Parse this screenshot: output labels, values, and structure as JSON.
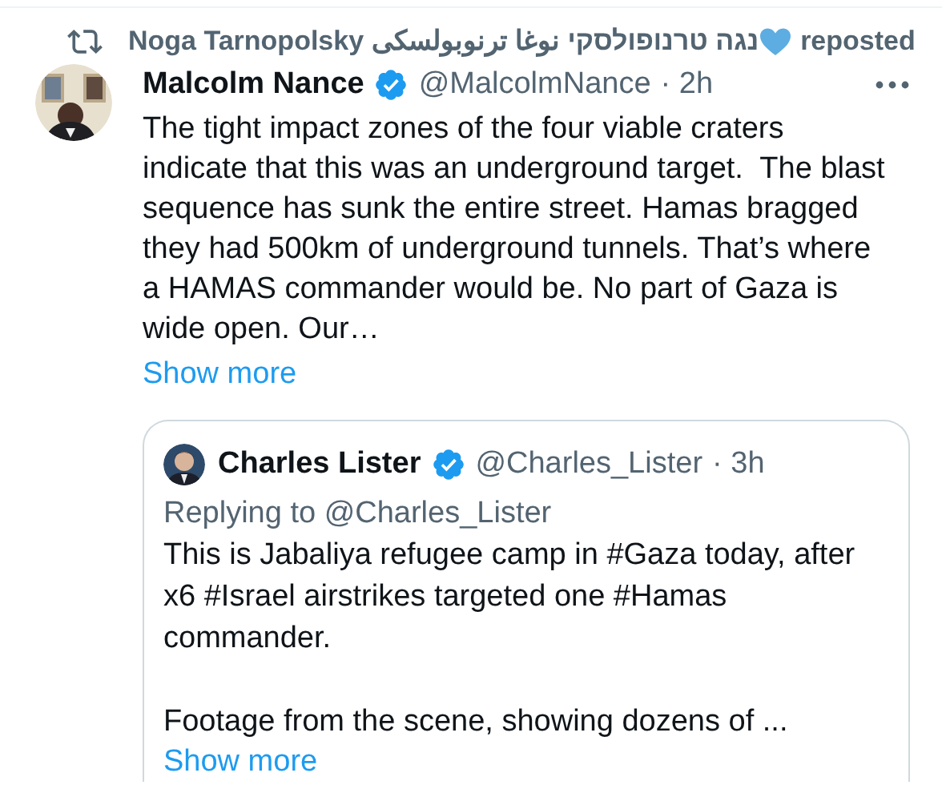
{
  "repost": {
    "name": "Noga Tarnopolsky נגה טרנופולסקי نوغا ترنوبولسكى",
    "label": "reposted"
  },
  "tweet": {
    "author": "Malcolm Nance",
    "verified": true,
    "handle": "@MalcolmNance",
    "time": "· 2h",
    "text": "The tight impact zones of the four viable craters indicate that this was an underground target.  The blast sequence has sunk the entire street. Hamas bragged they had 500km of underground tunnels. That’s where a HAMAS commander would be. No part of Gaza is wide open. Our…",
    "show_more": "Show more",
    "quote": {
      "author": "Charles Lister",
      "verified": true,
      "handle": "@Charles_Lister",
      "time": "· 3h",
      "replying": "Replying to @Charles_Lister",
      "text": "This is Jabaliya refugee camp in #Gaza today, after x6 #Israel airstrikes targeted one #Hamas commander.\n\nFootage from the scene, showing dozens of ...",
      "show_more": "Show more"
    }
  }
}
